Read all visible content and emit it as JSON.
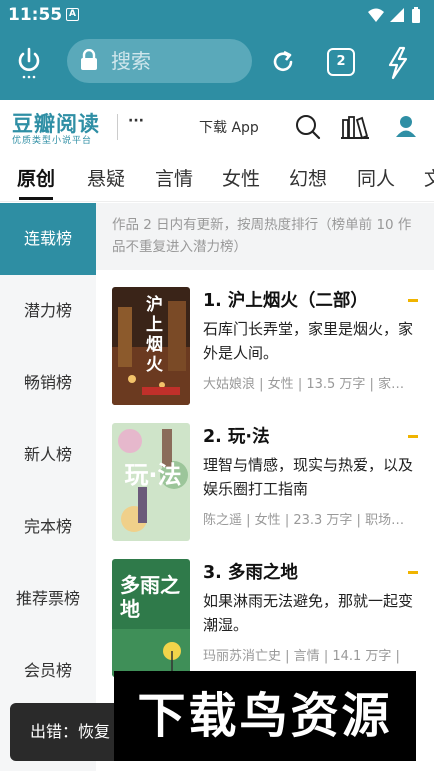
{
  "status_bar": {
    "time": "11:55",
    "notification": "A"
  },
  "browser": {
    "search_placeholder": "搜索",
    "tab_count": "2"
  },
  "site": {
    "logo_title": "豆瓣阅读",
    "logo_sub": "优质类型小说平台",
    "more": "···",
    "download": "下载 App"
  },
  "category_tabs": [
    "原创",
    "悬疑",
    "言情",
    "女性",
    "幻想",
    "同人",
    "文"
  ],
  "left_nav": [
    "连载榜",
    "潜力榜",
    "畅销榜",
    "新人榜",
    "完本榜",
    "推荐票榜",
    "会员榜"
  ],
  "notice": "作品 2 日内有更新，按周热度排行（榜单前 10 作品不重复进入潜力榜）",
  "books": [
    {
      "title": "1.  沪上烟火（二部）",
      "desc": "石库门长弄堂，家里是烟火，家外是人间。",
      "author": "大姑娘浪",
      "genre": "女性",
      "words": "13.5 万字",
      "extra": "家…",
      "cover_text": "沪上烟火"
    },
    {
      "title": "2.  玩·法",
      "desc": "理智与情感，现实与热爱，以及娱乐圈打工指南",
      "author": "陈之遥",
      "genre": "女性",
      "words": "23.3 万字",
      "extra": "职场…",
      "cover_text": "玩·法"
    },
    {
      "title": "3.  多雨之地",
      "desc": "如果淋雨无法避免，那就一起变潮湿。",
      "author": "玛丽苏消亡史",
      "genre": "言情",
      "words": "14.1 万字",
      "extra": "",
      "cover_text": "多雨之地"
    }
  ],
  "toast": "出错：恢复",
  "watermark": "下载鸟资源",
  "colors": {
    "primary": "#2e8ea3",
    "accent": "#f0b400"
  }
}
